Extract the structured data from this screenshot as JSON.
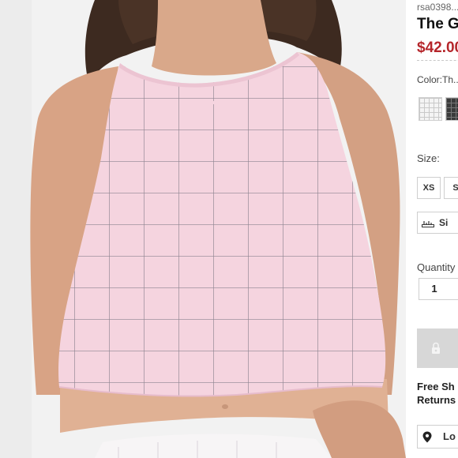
{
  "photo": {
    "subject": "model wearing a light pink sleeveless cropped top with a grey grid pattern",
    "background_color": "#f2f2f2",
    "garment_color": "#f5d4df",
    "grid_color": "#8e8590"
  },
  "product": {
    "sku": "rsa0398...",
    "title": "The G...",
    "price": "$42.00",
    "price_color": "#b5262b"
  },
  "color": {
    "label": "Color:",
    "selected": "Th...",
    "swatches": [
      {
        "name": "white-grid",
        "color": "#f4f4f4"
      },
      {
        "name": "black-grid",
        "color": "#3a3a3a"
      }
    ]
  },
  "size": {
    "label": "Size:",
    "options": [
      "XS",
      "S"
    ],
    "chart_button": "Si"
  },
  "quantity": {
    "label": "Quantity",
    "value": "1"
  },
  "cart": {
    "icon": "lock-icon",
    "button_color": "#d7d7d7"
  },
  "shipping": {
    "line1": "Free Sh",
    "line2": "Returns"
  },
  "store": {
    "locate_label": "Lo",
    "icon": "map-pin-icon"
  }
}
